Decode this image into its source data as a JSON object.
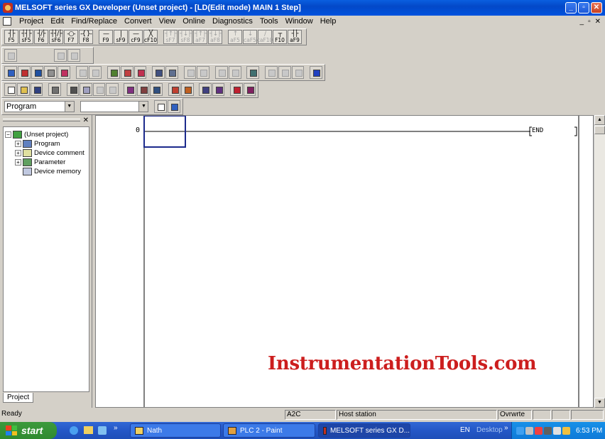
{
  "window": {
    "title": "MELSOFT series GX Developer (Unset project) - [LD(Edit mode)    MAIN    1 Step]",
    "minimize": "_",
    "maximize": "▫",
    "close": "✕"
  },
  "menu": {
    "items": [
      "Project",
      "Edit",
      "Find/Replace",
      "Convert",
      "View",
      "Online",
      "Diagnostics",
      "Tools",
      "Window",
      "Help"
    ],
    "mdi_min": "_",
    "mdi_restore": "▫",
    "mdi_close": "✕"
  },
  "ladder_toolbar": {
    "buttons": [
      {
        "sym": "┤├",
        "key": "F5"
      },
      {
        "sym": "┤┤├",
        "key": "sF5"
      },
      {
        "sym": "┤/├",
        "key": "F6"
      },
      {
        "sym": "┤┤/├",
        "key": "sF6"
      },
      {
        "sym": "-○-",
        "key": "F7"
      },
      {
        "sym": "-{ }-",
        "key": "F8"
      },
      {
        "sym": "—",
        "key": "F9"
      },
      {
        "sym": "|",
        "key": "sF9"
      },
      {
        "sym": "—",
        "key": "cF9"
      },
      {
        "sym": "╳",
        "key": "cF10"
      },
      {
        "sym": "┤↑├",
        "key": "sF7"
      },
      {
        "sym": "┤↓├",
        "key": "sF8"
      },
      {
        "sym": "┤↑├",
        "key": "aF7"
      },
      {
        "sym": "┤↓├",
        "key": "aF8"
      },
      {
        "sym": "↑",
        "key": "aF5"
      },
      {
        "sym": "↓",
        "key": "caF5"
      },
      {
        "sym": "/",
        "key": "caF10"
      },
      {
        "sym": "┬",
        "key": "F10"
      },
      {
        "sym": "┤├",
        "key": "aF9"
      }
    ]
  },
  "combo_program": {
    "value": "Program"
  },
  "combo_second": {
    "value": ""
  },
  "panel": {
    "close": "✕",
    "tab": "Project",
    "tree": {
      "root": "(Unset project)",
      "children": [
        "Program",
        "Device comment",
        "Parameter",
        "Device memory"
      ]
    }
  },
  "ladder": {
    "step": "0",
    "end": "END"
  },
  "status": {
    "ready": "Ready",
    "cpu": "A2C",
    "station": "Host station",
    "mode": "Ovrwrte"
  },
  "taskbar": {
    "start": "start",
    "quick_more": "»",
    "tasks": [
      "Nath",
      "PLC 2 - Paint",
      "MELSOFT series GX D..."
    ],
    "lang": "EN",
    "desktop": "Desktop",
    "tray_more": "»",
    "clock": "6:53 PM"
  },
  "watermark": "InstrumentationTools.com",
  "colors": {
    "titlebar": "#0348c8",
    "taskbar": "#2457c7",
    "start": "#2f8a2f",
    "watermark": "#cc1e1e",
    "cursor": "#1c2a8c"
  }
}
